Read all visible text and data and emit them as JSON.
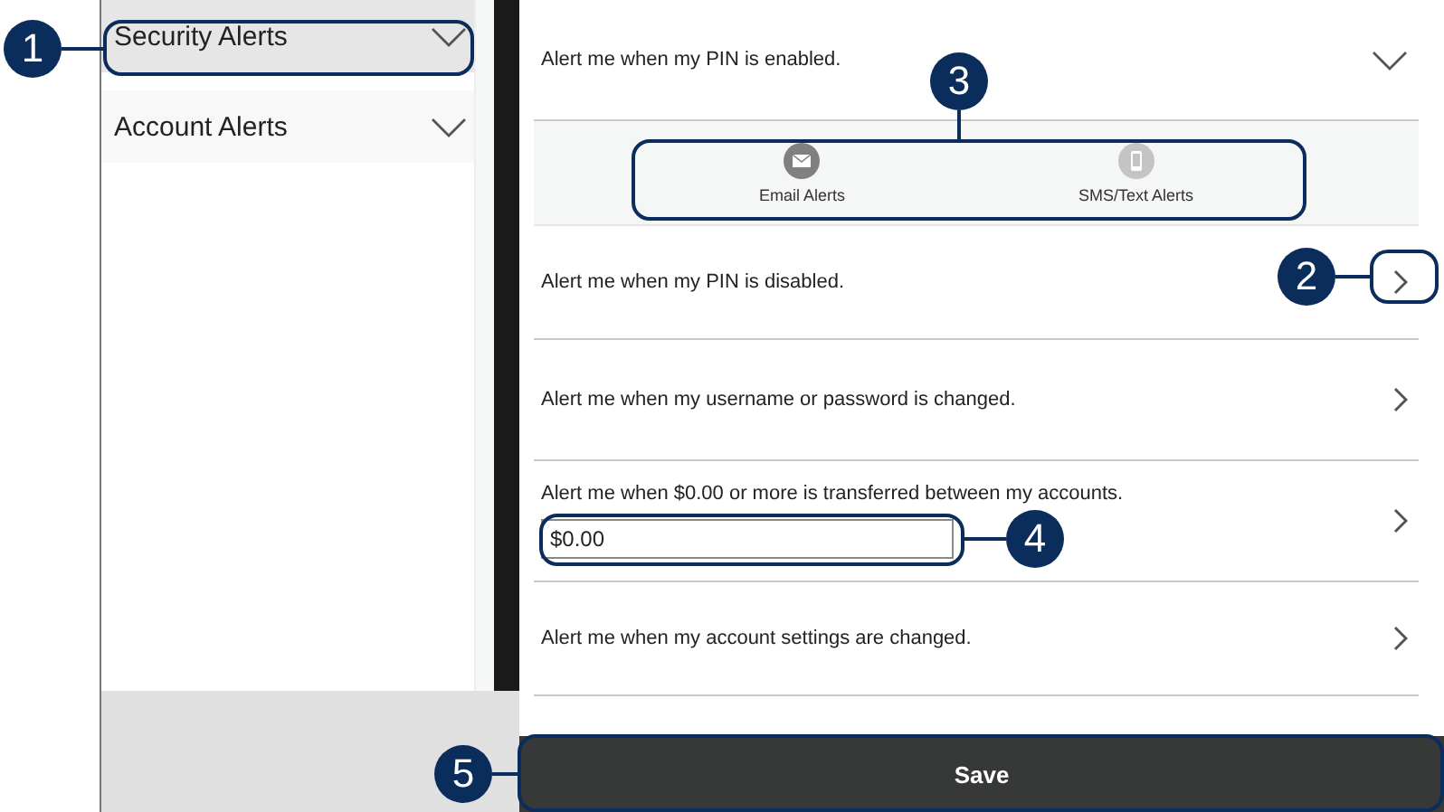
{
  "sidebar": {
    "items": [
      {
        "label": "Security Alerts",
        "selected": true
      },
      {
        "label": "Account Alerts",
        "selected": false
      }
    ]
  },
  "alerts": [
    {
      "kind": "plain",
      "label": "Alert me when my PIN is enabled.",
      "expanded": true,
      "channels": [
        {
          "label": "Email Alerts",
          "on": true
        },
        {
          "label": "SMS/Text Alerts",
          "on": false
        }
      ]
    },
    {
      "kind": "plain",
      "label": "Alert me when my PIN is disabled.",
      "expanded": false
    },
    {
      "kind": "plain",
      "label": "Alert me when my username or password is changed.",
      "expanded": false
    },
    {
      "kind": "amount",
      "label": "Alert me when $0.00 or more is transferred between my accounts.",
      "value": "$0.00",
      "expanded": false
    },
    {
      "kind": "plain",
      "label": "Alert me when my account settings are changed.",
      "expanded": false
    }
  ],
  "save_button": "Save",
  "callouts": [
    {
      "number": "1"
    },
    {
      "number": "2"
    },
    {
      "number": "3"
    },
    {
      "number": "4"
    },
    {
      "number": "5"
    }
  ]
}
